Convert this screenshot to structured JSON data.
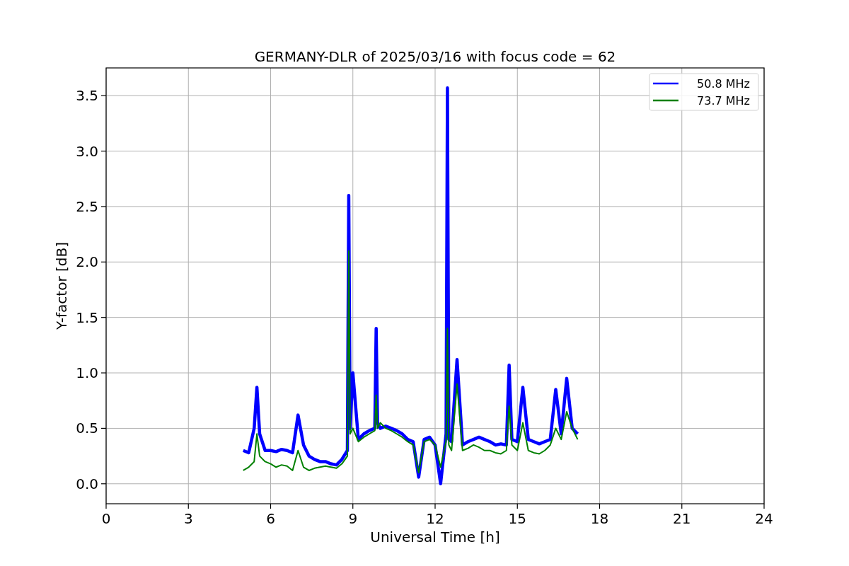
{
  "figure": {
    "chart_data": {
      "type": "line",
      "title": "GERMANY-DLR of 2025/03/16 with focus code = 62",
      "xlabel": "Universal Time [h]",
      "ylabel": "Y-factor [dB]",
      "x": [
        5.0,
        5.2,
        5.4,
        5.5,
        5.6,
        5.8,
        6.0,
        6.2,
        6.4,
        6.6,
        6.8,
        7.0,
        7.2,
        7.4,
        7.6,
        7.8,
        8.0,
        8.2,
        8.4,
        8.6,
        8.8,
        8.85,
        8.9,
        9.0,
        9.2,
        9.4,
        9.6,
        9.8,
        9.85,
        9.9,
        10.0,
        10.2,
        10.4,
        10.6,
        10.8,
        11.0,
        11.2,
        11.4,
        11.6,
        11.8,
        12.0,
        12.2,
        12.4,
        12.45,
        12.5,
        12.6,
        12.8,
        13.0,
        13.2,
        13.4,
        13.6,
        13.8,
        14.0,
        14.2,
        14.4,
        14.6,
        14.7,
        14.8,
        15.0,
        15.2,
        15.4,
        15.6,
        15.8,
        16.0,
        16.2,
        16.4,
        16.6,
        16.8,
        17.0,
        17.2
      ],
      "series": [
        {
          "name": "50.8 MHz",
          "color": "#0000ff",
          "values": [
            0.3,
            0.28,
            0.5,
            0.87,
            0.45,
            0.3,
            0.3,
            0.29,
            0.31,
            0.3,
            0.28,
            0.62,
            0.35,
            0.25,
            0.22,
            0.2,
            0.2,
            0.18,
            0.17,
            0.22,
            0.3,
            2.6,
            0.5,
            1.0,
            0.4,
            0.45,
            0.48,
            0.5,
            1.4,
            0.55,
            0.5,
            0.52,
            0.5,
            0.48,
            0.45,
            0.4,
            0.38,
            0.06,
            0.4,
            0.42,
            0.35,
            0.0,
            0.45,
            3.57,
            0.4,
            0.38,
            1.12,
            0.35,
            0.38,
            0.4,
            0.42,
            0.4,
            0.38,
            0.35,
            0.36,
            0.35,
            1.07,
            0.4,
            0.38,
            0.87,
            0.4,
            0.38,
            0.36,
            0.38,
            0.4,
            0.85,
            0.45,
            0.95,
            0.5,
            0.45
          ]
        },
        {
          "name": "73.7 MHz",
          "color": "#008000",
          "values": [
            0.12,
            0.15,
            0.2,
            0.45,
            0.25,
            0.2,
            0.18,
            0.15,
            0.17,
            0.16,
            0.12,
            0.3,
            0.15,
            0.12,
            0.14,
            0.15,
            0.16,
            0.15,
            0.14,
            0.18,
            0.25,
            2.1,
            0.45,
            0.5,
            0.38,
            0.42,
            0.45,
            0.48,
            0.8,
            0.5,
            0.55,
            0.5,
            0.48,
            0.45,
            0.42,
            0.38,
            0.35,
            0.1,
            0.38,
            0.4,
            0.35,
            0.15,
            0.38,
            1.4,
            0.35,
            0.3,
            0.9,
            0.3,
            0.32,
            0.35,
            0.33,
            0.3,
            0.3,
            0.28,
            0.27,
            0.3,
            0.7,
            0.35,
            0.3,
            0.55,
            0.3,
            0.28,
            0.27,
            0.3,
            0.35,
            0.5,
            0.4,
            0.65,
            0.5,
            0.4
          ]
        }
      ],
      "grid": true,
      "legend": true,
      "xlim": [
        0,
        24
      ],
      "ylim": [
        -0.18,
        3.75
      ],
      "xticks": [
        0,
        3,
        6,
        9,
        12,
        15,
        18,
        21,
        24
      ],
      "yticks": [
        {
          "value": 0,
          "label": "0.0"
        },
        {
          "value": 0.5,
          "label": "0.5"
        },
        {
          "value": 1,
          "label": "1.0"
        },
        {
          "value": 1.5,
          "label": "1.5"
        },
        {
          "value": 2,
          "label": "2.0"
        },
        {
          "value": 2.5,
          "label": "2.5"
        },
        {
          "value": 3,
          "label": "3.0"
        },
        {
          "value": 3.5,
          "label": "3.5"
        }
      ]
    }
  }
}
